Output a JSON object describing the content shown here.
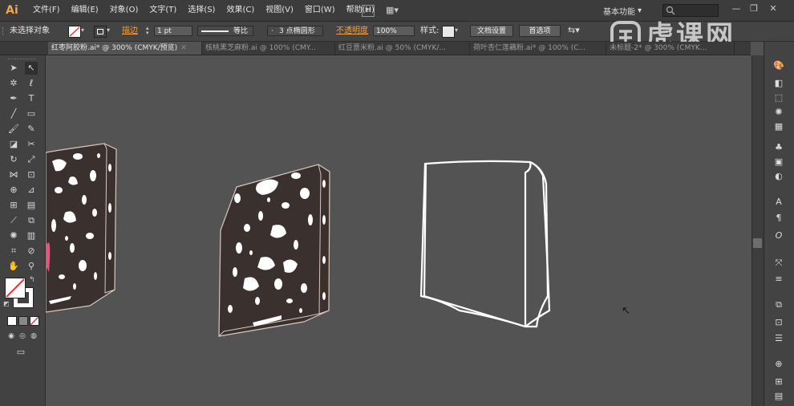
{
  "app": {
    "logo": "Ai",
    "bridge_label": "Br"
  },
  "menu": [
    "文件(F)",
    "编辑(E)",
    "对象(O)",
    "文字(T)",
    "选择(S)",
    "效果(C)",
    "视图(V)",
    "窗口(W)",
    "帮助(H)"
  ],
  "workspace": {
    "label": "基本功能",
    "arrow": "▾"
  },
  "window_controls": {
    "minimize": "—",
    "restore": "❐",
    "close": "✕"
  },
  "control_bar": {
    "selection_status": "未选择对象",
    "stroke_label": "描边",
    "stroke_weight": "1 pt",
    "profile_label": "等比",
    "brush_label": "3 点椭圆形",
    "opacity_label": "不透明度",
    "opacity_value": "100%",
    "style_label": "样式:",
    "doc_setup_button": "文档设置",
    "preferences_button": "首选项"
  },
  "tabs": [
    {
      "label": "红枣阿胶粉.ai* @ 300% (CMYK/预览)",
      "active": true
    },
    {
      "label": "核桃黑芝麻粉.ai @ 100% (CMY...",
      "active": false
    },
    {
      "label": "红豆薏米粉.ai @ 50% (CMYK/...",
      "active": false
    },
    {
      "label": "荷叶杏仁莲藕粉.ai* @ 100% (C...",
      "active": false
    },
    {
      "label": "未标题-2* @ 300% (CMYK...",
      "active": false
    }
  ],
  "tools": [
    "selection-icon",
    "direct-selection-icon",
    "magic-wand-icon",
    "lasso-icon",
    "pen-icon",
    "type-icon",
    "line-icon",
    "rectangle-icon",
    "paintbrush-icon",
    "pencil-icon",
    "eraser-icon",
    "scissors-icon",
    "rotate-icon",
    "scale-icon",
    "width-icon",
    "free-transform-icon",
    "shape-builder-icon",
    "perspective-icon",
    "mesh-icon",
    "gradient-icon",
    "eyedropper-icon",
    "blend-icon",
    "symbol-sprayer-icon",
    "column-graph-icon",
    "artboard-icon",
    "slice-icon",
    "hand-icon",
    "zoom-icon"
  ],
  "watermark": "虎课网",
  "colors": {
    "canvas": "#535353",
    "block_fill": "#3a302d",
    "block_edge": "#d9c8bd",
    "speckle": "#ffffff",
    "outline": "#ffffff",
    "accent_pink": "#e0577a",
    "stroke_none_red": "#e23a3a"
  }
}
